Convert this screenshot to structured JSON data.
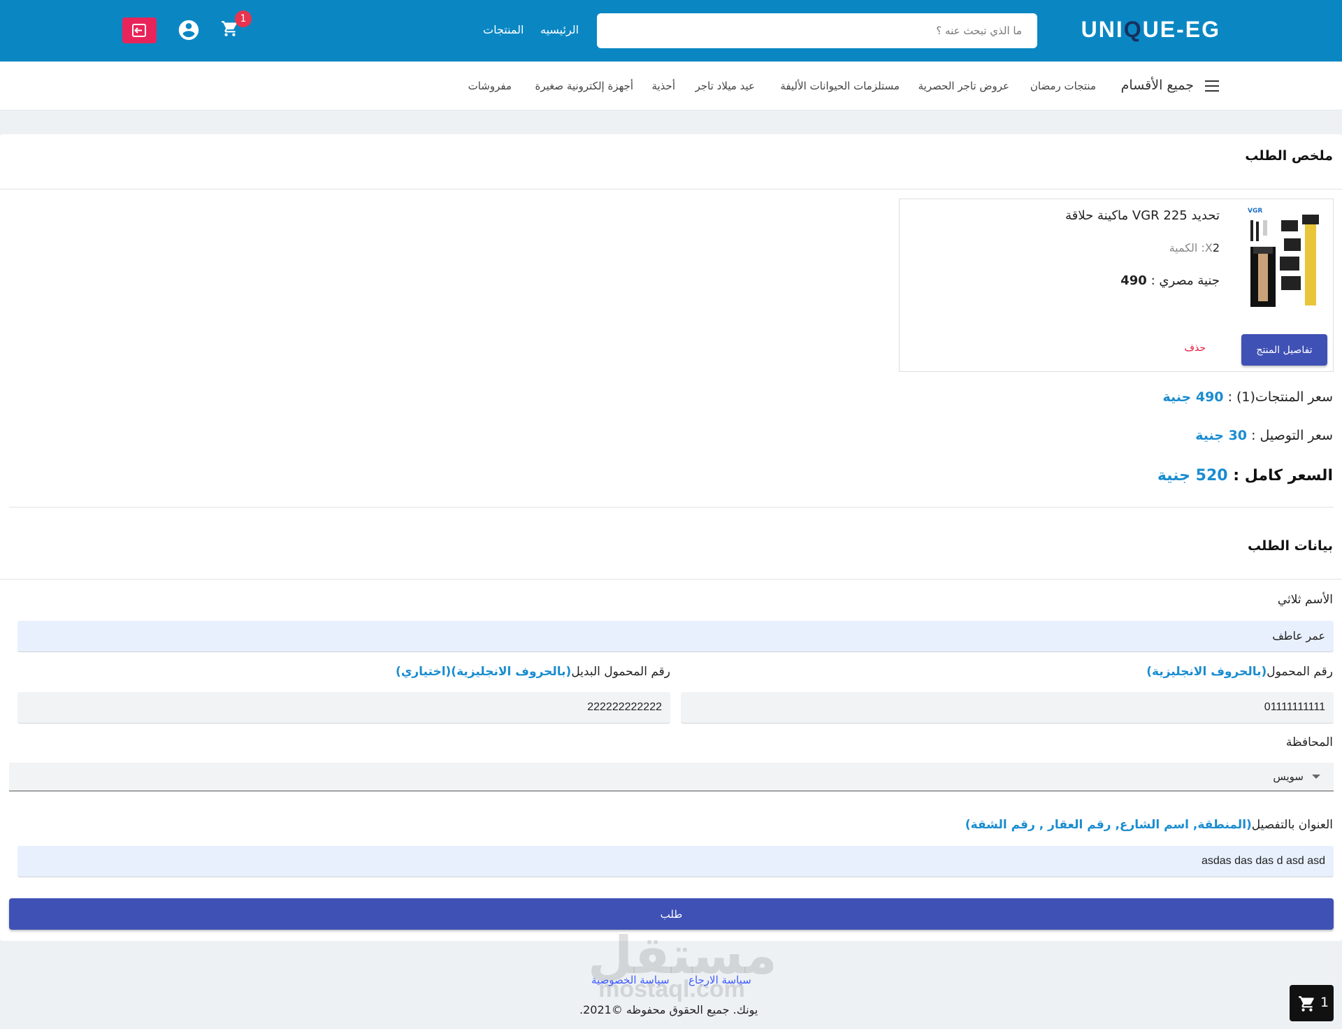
{
  "header": {
    "logo_left": "UNI",
    "logo_q": "Q",
    "logo_right": "UE-EG",
    "search_placeholder": "ما الذي تبحث عنه ؟",
    "nav_home": "الرئيسيه",
    "nav_products": "المنتجات",
    "cart_count": "1",
    "brand_color": "#0a87c3",
    "icons": [
      "cart-icon",
      "user-icon",
      "logout-icon"
    ]
  },
  "categories": {
    "all_label": "جميع الأقسام",
    "items": [
      "منتجات رمضان",
      "عروض تاجر الحصرية",
      "مستلزمات الحيوانات الأليفة",
      "عيد ميلاد تاجر",
      "أحذية",
      "أجهزة إلكترونية صغيرة",
      "مفروشات"
    ]
  },
  "order_summary": {
    "title": "ملخص الطلب",
    "product": {
      "name": "ماكينة حلاقة VGR 225 تحديد",
      "qty_label": "الكمية :X",
      "qty_value": "2",
      "price_value": "490",
      "price_currency": ": جنية مصري",
      "details_button": "تفاصيل المنتج",
      "delete_label": "حذف"
    },
    "products_price_label": "سعر المنتجات(1) :",
    "products_price_value": "490 جنية",
    "delivery_label": "سعر التوصيل :",
    "delivery_value": "30 جنية",
    "total_label": "السعر كامل :",
    "total_value": "520 جنية"
  },
  "order_data": {
    "title": "بيانات الطلب",
    "name_label": "الأسم ثلاثي",
    "name_value": "عمر عاطف",
    "phone_label": "رقم المحمول",
    "phone_hint": "(بالحروف الانجليزية)",
    "phone_value": "01111111111",
    "alt_phone_label": "رقم المحمول البديل",
    "alt_phone_hint": "(بالحروف الانجليزية)(اختياري)",
    "alt_phone_value": "222222222222",
    "governorate_label": "المحافظة",
    "governorate_value": "سويس",
    "address_label": "العنوان بالتفصيل",
    "address_hint": "(المنطقة, اسم الشارع, رقم العقار , رقم الشقة)",
    "address_value": "asdas das das d asd asd",
    "submit_label": "طلب"
  },
  "footer": {
    "return_policy": "سياسة الارجاع",
    "privacy_policy": "سياسة الخصوصية",
    "copyright": ".يونك. جميع الحقوق محفوظه ©2021",
    "watermark_ar": "مستقل",
    "watermark_en": "mostaql.com",
    "floating_cart_count": "1"
  }
}
